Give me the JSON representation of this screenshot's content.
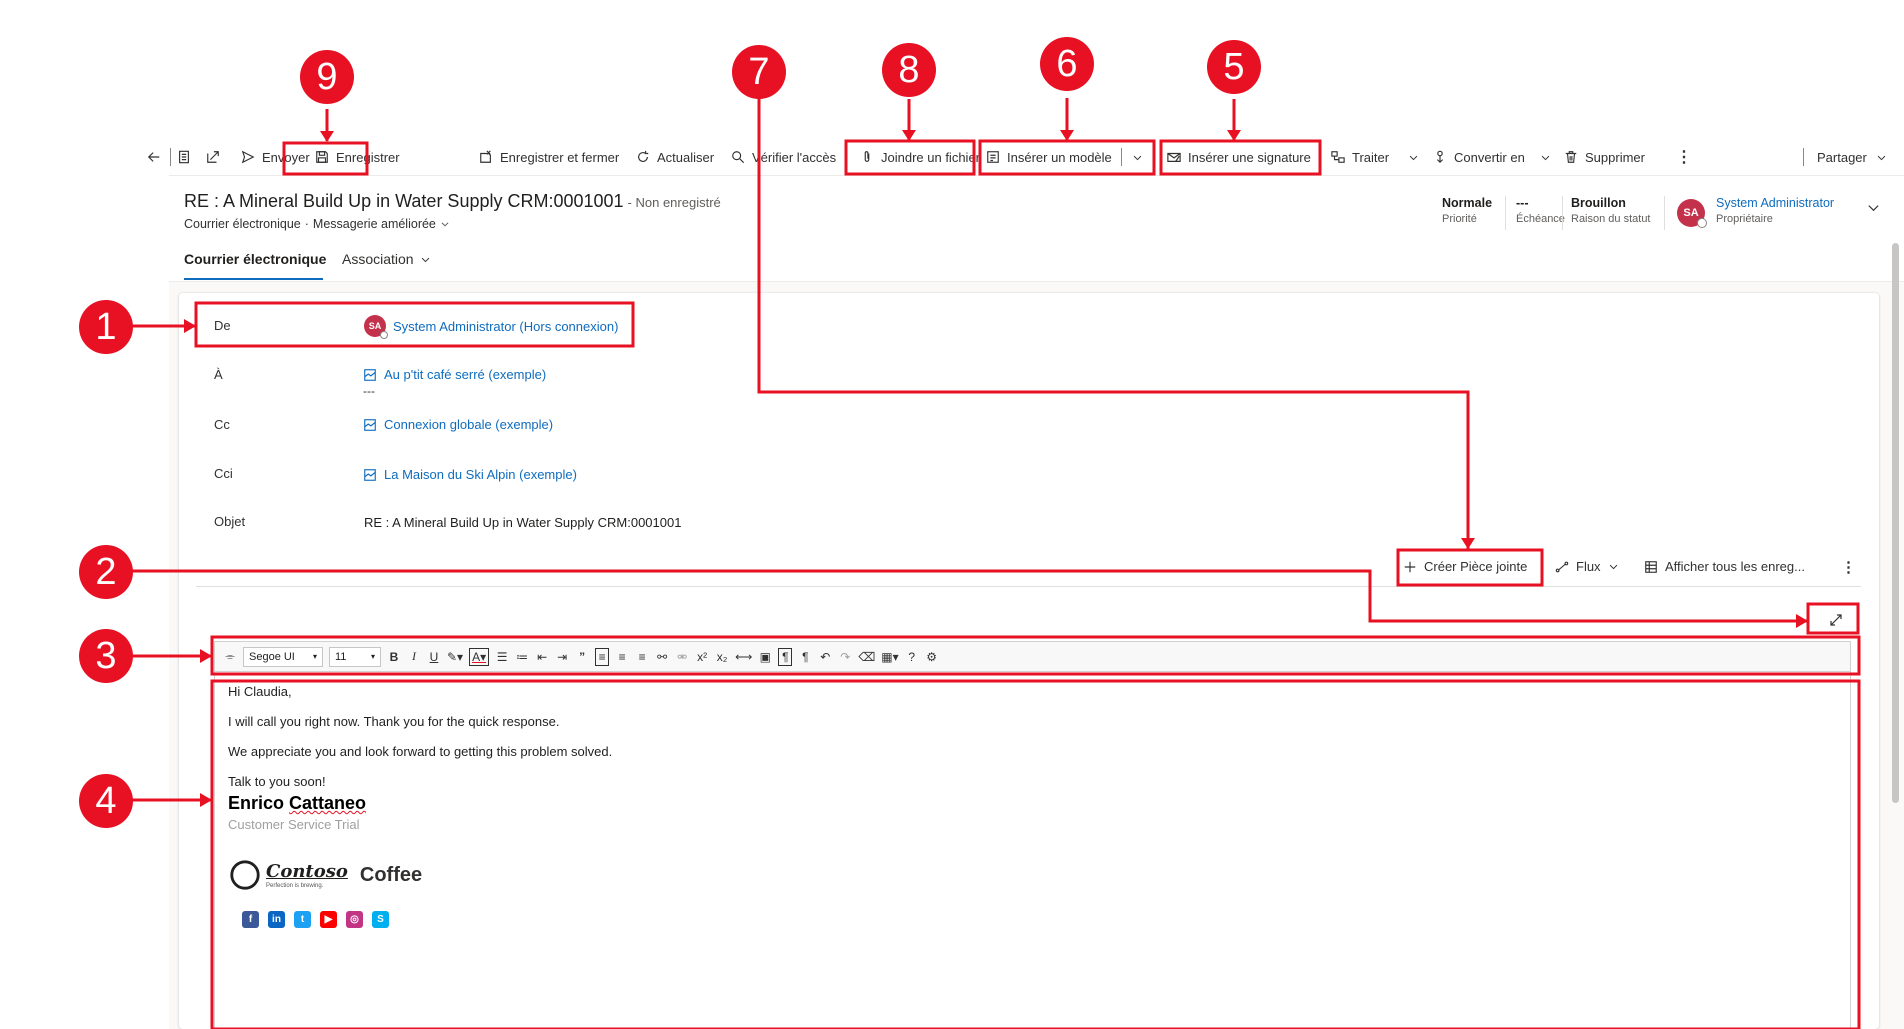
{
  "command_bar": {
    "send": "Envoyer",
    "save": "Enregistrer",
    "save_close": "Enregistrer et fermer",
    "refresh": "Actualiser",
    "check_access": "Vérifier l'accès",
    "attach_file": "Joindre un fichier",
    "insert_template": "Insérer un modèle",
    "insert_signature": "Insérer une signature",
    "process": "Traiter",
    "convert": "Convertir en",
    "delete": "Supprimer",
    "share": "Partager"
  },
  "record": {
    "title": "RE : A Mineral Build Up in Water Supply CRM:0001001",
    "unsaved": "- Non enregistré",
    "entity": "Courrier électronique",
    "form": "Messagerie améliorée"
  },
  "header_fields": {
    "priority_value": "Normale",
    "priority_label": "Priorité",
    "due_value": "---",
    "due_label": "Échéance",
    "status_value": "Brouillon",
    "status_label": "Raison du statut",
    "owner_initials": "SA",
    "owner_name": "System Administrator",
    "owner_label": "Propriétaire"
  },
  "tabs": [
    "Courrier électronique",
    "Association"
  ],
  "fields": {
    "from_label": "De",
    "from_initials": "SA",
    "from_value": "System Administrator (Hors connexion)",
    "to_label": "À",
    "to_value": "Au p'tit café serré (exemple)",
    "to_extra": "---",
    "cc_label": "Cc",
    "cc_value": "Connexion globale (exemple)",
    "bcc_label": "Cci",
    "bcc_value": "La Maison du Ski Alpin (exemple)",
    "subject_label": "Objet",
    "subject_value": "RE : A Mineral Build Up in Water Supply CRM:0001001"
  },
  "subgrid_bar": {
    "create_attachment": "Créer Pièce jointe",
    "flow": "Flux",
    "show_all": "Afficher tous les enreg..."
  },
  "editor_toolbar": {
    "font_family": "Segoe UI",
    "font_size": "11"
  },
  "email_body": {
    "greeting": "Hi Claudia,",
    "line1": "I will call you right now. Thank you for the quick response.",
    "line2": "We appreciate you and look forward to getting this problem solved.",
    "closing": "Talk to you soon!",
    "sig_first": "Enrico",
    "sig_last": "Cattaneo",
    "sig_title": "Customer Service Trial",
    "logo_brand": "Contoso",
    "logo_tagline": "Perfection is brewing.",
    "logo_word": "Coffee",
    "social_icons": [
      "facebook-icon",
      "linkedin-icon",
      "twitter-icon",
      "youtube-icon",
      "instagram-icon",
      "skype-icon"
    ]
  },
  "annotations": {
    "badges": [
      "1",
      "2",
      "3",
      "4",
      "5",
      "6",
      "7",
      "8",
      "9"
    ],
    "color": "#e81123"
  },
  "colors": {
    "link": "#0f6cbd",
    "avatar": "#c4314b",
    "annotation": "#e81123"
  }
}
